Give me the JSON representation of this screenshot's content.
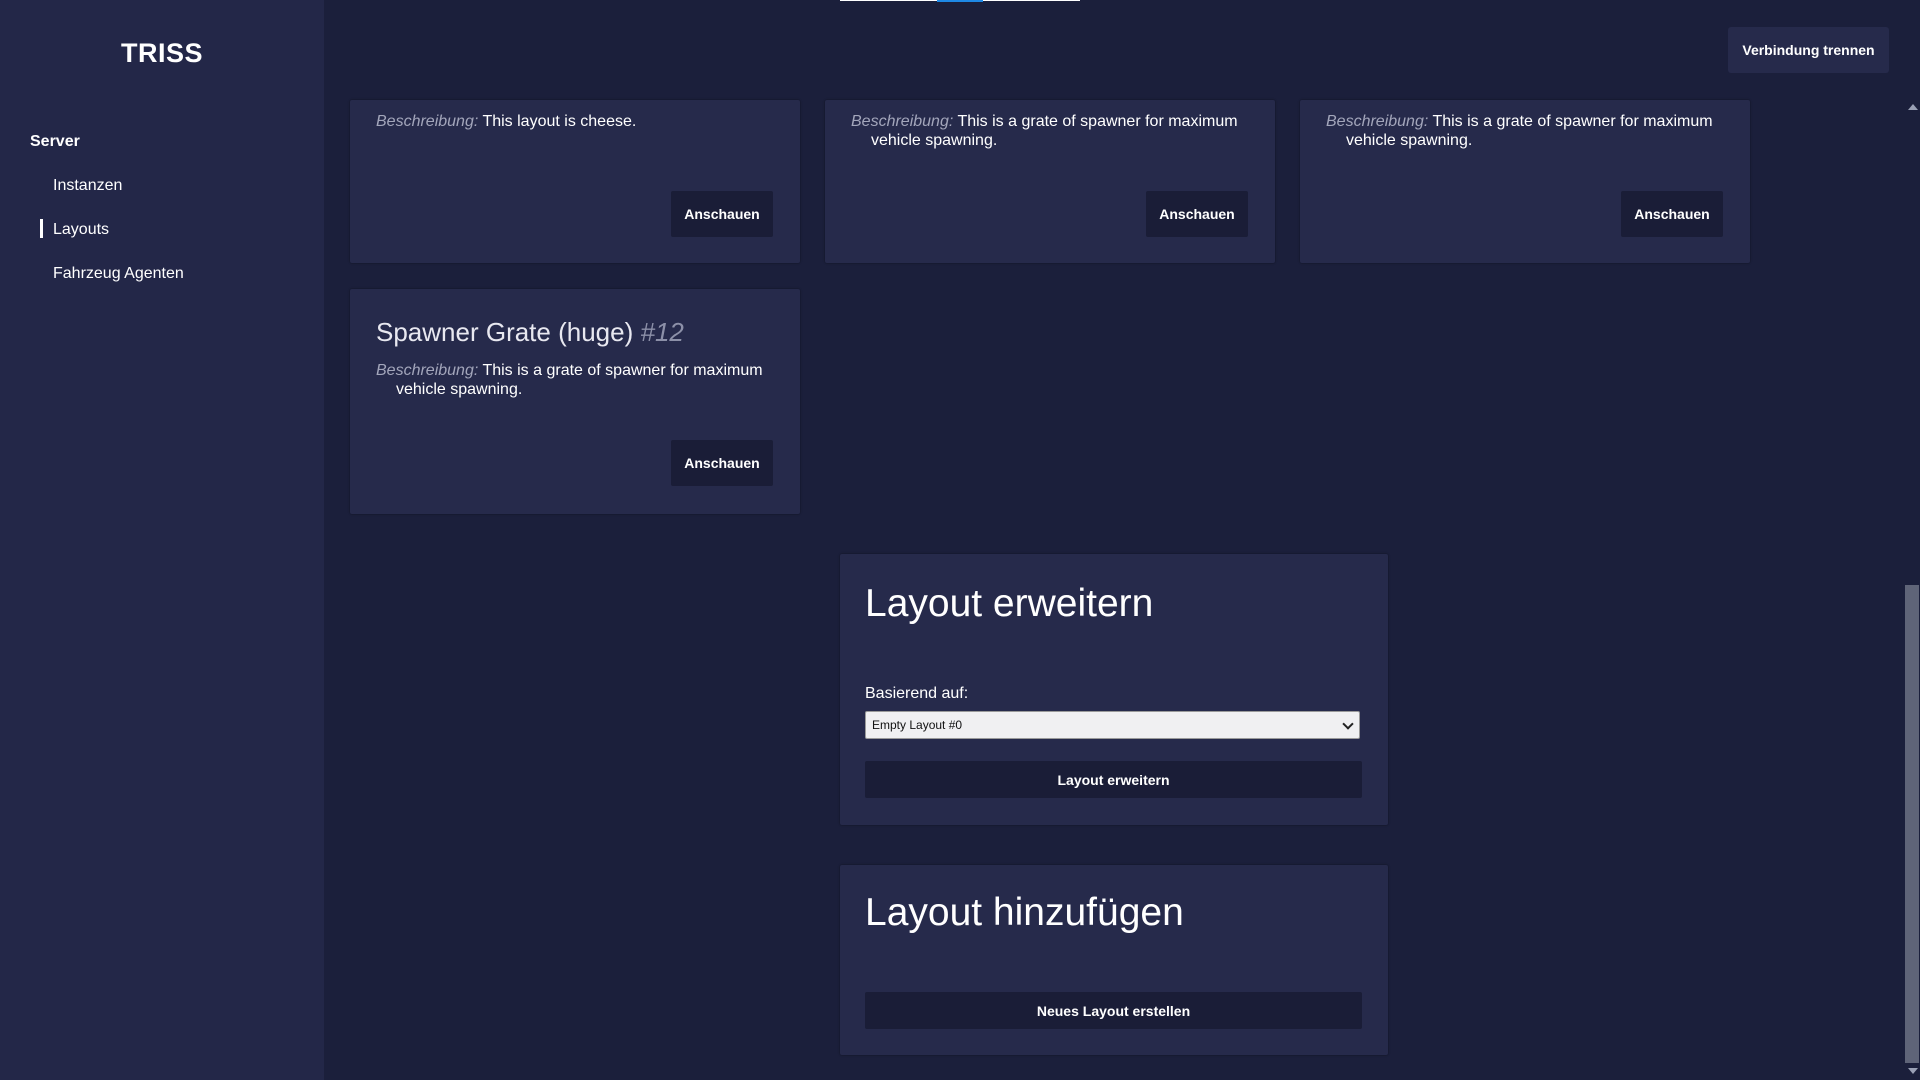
{
  "app": {
    "brand": "TRISS"
  },
  "sidebar": {
    "heading": "Server",
    "items": [
      {
        "label": "Instanzen",
        "active": false
      },
      {
        "label": "Layouts",
        "active": true
      },
      {
        "label": "Fahrzeug Agenten",
        "active": false
      }
    ]
  },
  "header": {
    "disconnect_label": "Verbindung trennen"
  },
  "cards": [
    {
      "desc_label": "Beschreibung:",
      "desc_line1": "This layout is cheese.",
      "desc_line2": "",
      "button": "Anschauen"
    },
    {
      "desc_label": "Beschreibung:",
      "desc_line1": "This is a grate of spawner for maximum",
      "desc_line2": "vehicle spawning.",
      "button": "Anschauen"
    },
    {
      "desc_label": "Beschreibung:",
      "desc_line1": "This is a grate of spawner for maximum",
      "desc_line2": "vehicle spawning.",
      "button": "Anschauen"
    },
    {
      "title": "Spawner Grate (huge)",
      "number": "#12",
      "desc_label": "Beschreibung:",
      "desc_line1": "This is a grate of spawner for maximum",
      "desc_line2": "vehicle spawning.",
      "button": "Anschauen"
    }
  ],
  "extend_panel": {
    "title": "Layout erweitern",
    "based_on_label": "Basierend auf:",
    "selected_option": "Empty Layout #0",
    "button": "Layout erweitern"
  },
  "add_panel": {
    "title": "Layout hinzufügen",
    "button": "Neues Layout erstellen"
  }
}
